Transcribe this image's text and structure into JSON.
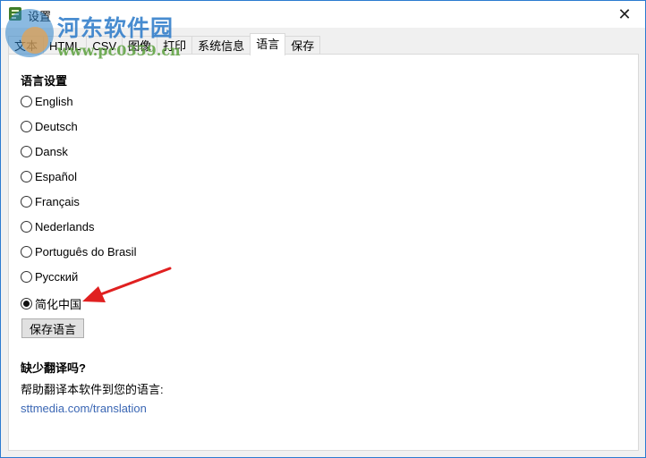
{
  "window": {
    "title": "设置",
    "close_icon": "✕"
  },
  "tabs": [
    {
      "label": "文本",
      "active": false
    },
    {
      "label": "HTML",
      "active": false
    },
    {
      "label": "CSV",
      "active": false
    },
    {
      "label": "图像",
      "active": false
    },
    {
      "label": "打印",
      "active": false
    },
    {
      "label": "系统信息",
      "active": false
    },
    {
      "label": "语言",
      "active": true
    },
    {
      "label": "保存",
      "active": false
    }
  ],
  "language_panel": {
    "section_title": "语言设置",
    "options": [
      {
        "label": "English",
        "checked": false
      },
      {
        "label": "Deutsch",
        "checked": false
      },
      {
        "label": "Dansk",
        "checked": false
      },
      {
        "label": "Español",
        "checked": false
      },
      {
        "label": "Français",
        "checked": false
      },
      {
        "label": "Nederlands",
        "checked": false
      },
      {
        "label": "Português do Brasil",
        "checked": false
      },
      {
        "label": "Русский",
        "checked": false
      },
      {
        "label": "简化中国",
        "checked": true
      }
    ],
    "save_button_label": "保存语言",
    "missing_title": "缺少翻译吗?",
    "help_text": "帮助翻译本软件到您的语言:",
    "link_text": "sttmedia.com/translation"
  },
  "watermark": {
    "site_name": "河东软件园",
    "site_url": "www.pc0359.cn"
  },
  "colors": {
    "link": "#3b67b4",
    "window_border": "#2b7bd0",
    "annotation_arrow": "#e02020"
  }
}
